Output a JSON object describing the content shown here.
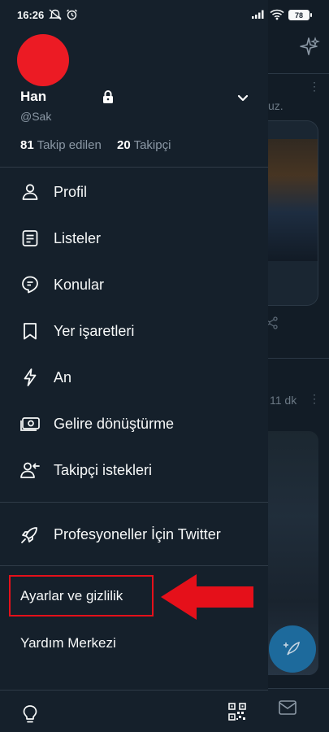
{
  "status_bar": {
    "time": "16:26",
    "battery": "78"
  },
  "profile": {
    "name": "Han",
    "handle": "@Sak",
    "following_count": "81",
    "following_label": "Takip edilen",
    "followers_count": "20",
    "followers_label": "Takipçi",
    "avatar_color": "#ec1b24"
  },
  "menu": {
    "items": [
      {
        "label": "Profil",
        "icon": "person-icon"
      },
      {
        "label": "Listeler",
        "icon": "list-icon"
      },
      {
        "label": "Konular",
        "icon": "topics-icon"
      },
      {
        "label": "Yer işaretleri",
        "icon": "bookmark-icon"
      },
      {
        "label": "An",
        "icon": "lightning-icon"
      },
      {
        "label": "Gelire dönüştürme",
        "icon": "money-icon"
      },
      {
        "label": "Takipçi istekleri",
        "icon": "follower-request-icon"
      }
    ],
    "professional": {
      "label": "Profesyoneller İçin Twitter",
      "icon": "rocket-icon"
    },
    "settings_label": "Ayarlar ve gizlilik",
    "help_label": "Yardım Merkezi"
  },
  "background": {
    "partial_text": "uz.",
    "timestamp": "11 dk"
  },
  "colors": {
    "drawer_bg": "#15202b",
    "accent_red": "#e5101a",
    "fab": "#1d6a9c"
  }
}
